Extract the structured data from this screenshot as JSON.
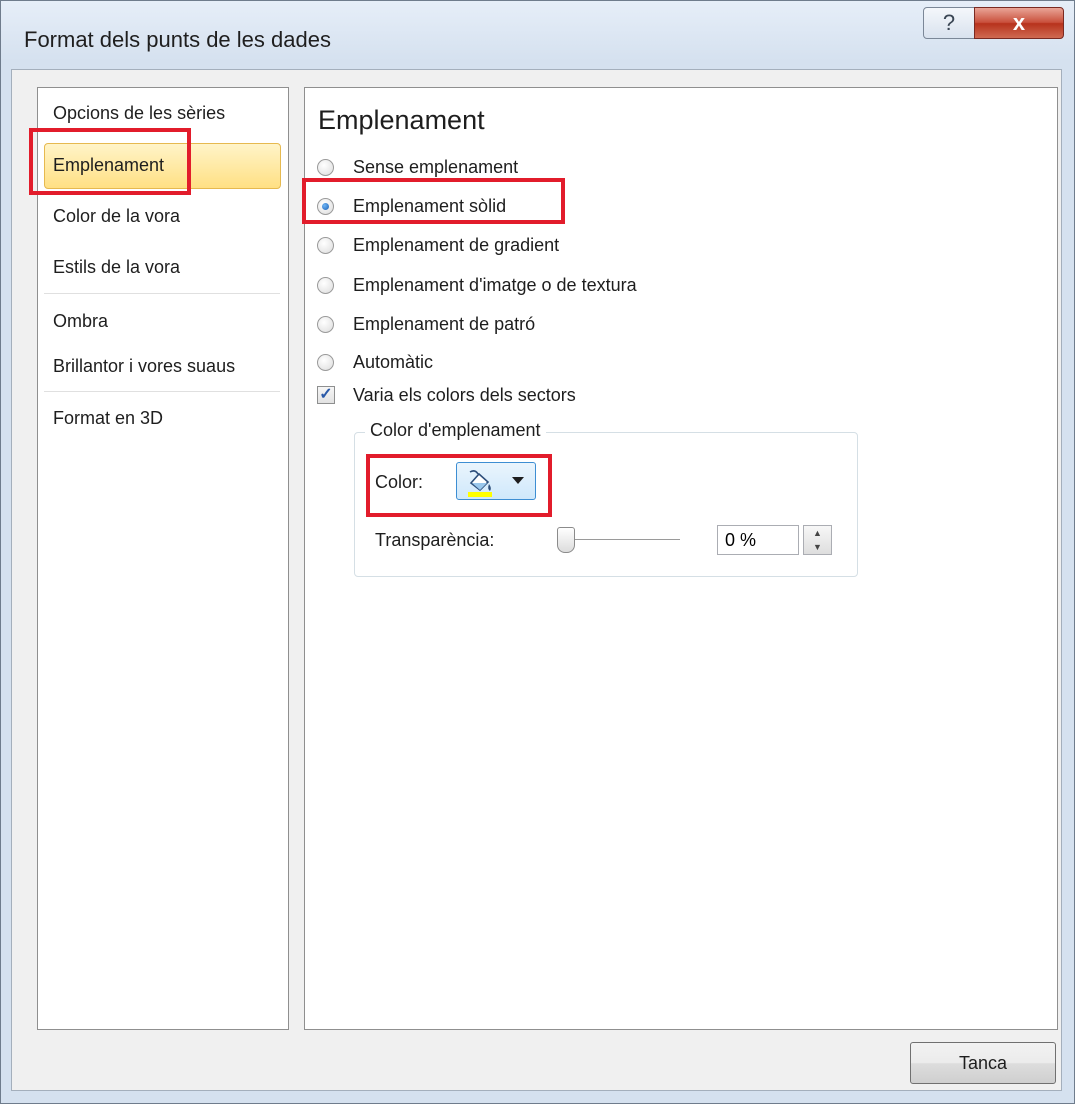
{
  "window": {
    "title": "Format dels punts de les dades",
    "help_glyph": "?",
    "close_glyph": "x"
  },
  "sidebar": {
    "items": [
      {
        "label": "Opcions de les sèries",
        "selected": false
      },
      {
        "label": "Emplenament",
        "selected": true
      },
      {
        "label": "Color de la vora",
        "selected": false
      },
      {
        "label": "Estils de la vora",
        "selected": false
      },
      {
        "label": "Ombra",
        "selected": false
      },
      {
        "label": "Brillantor i vores suaus",
        "selected": false
      },
      {
        "label": "Format en 3D",
        "selected": false
      }
    ]
  },
  "fill": {
    "heading": "Emplenament",
    "options": [
      {
        "label": "Sense emplenament",
        "checked": false
      },
      {
        "label": "Emplenament sòlid",
        "checked": true
      },
      {
        "label": "Emplenament de gradient",
        "checked": false
      },
      {
        "label": "Emplenament d'imatge o de textura",
        "checked": false
      },
      {
        "label": "Emplenament de patró",
        "checked": false
      },
      {
        "label": "Automàtic",
        "checked": false
      }
    ],
    "vary_colors": {
      "label": "Varia els colors dels sectors",
      "checked": true
    },
    "group": {
      "title": "Color d'emplenament",
      "color_label": "Color:",
      "color_value": "#ffff00",
      "transparency_label": "Transparència:",
      "transparency_value": "0 %",
      "transparency_percent": 0
    }
  },
  "buttons": {
    "close_label": "Tanca"
  },
  "colors": {
    "highlight": "#e21c2b",
    "selection": "#ffe084",
    "accent": "#3d8ed3"
  }
}
